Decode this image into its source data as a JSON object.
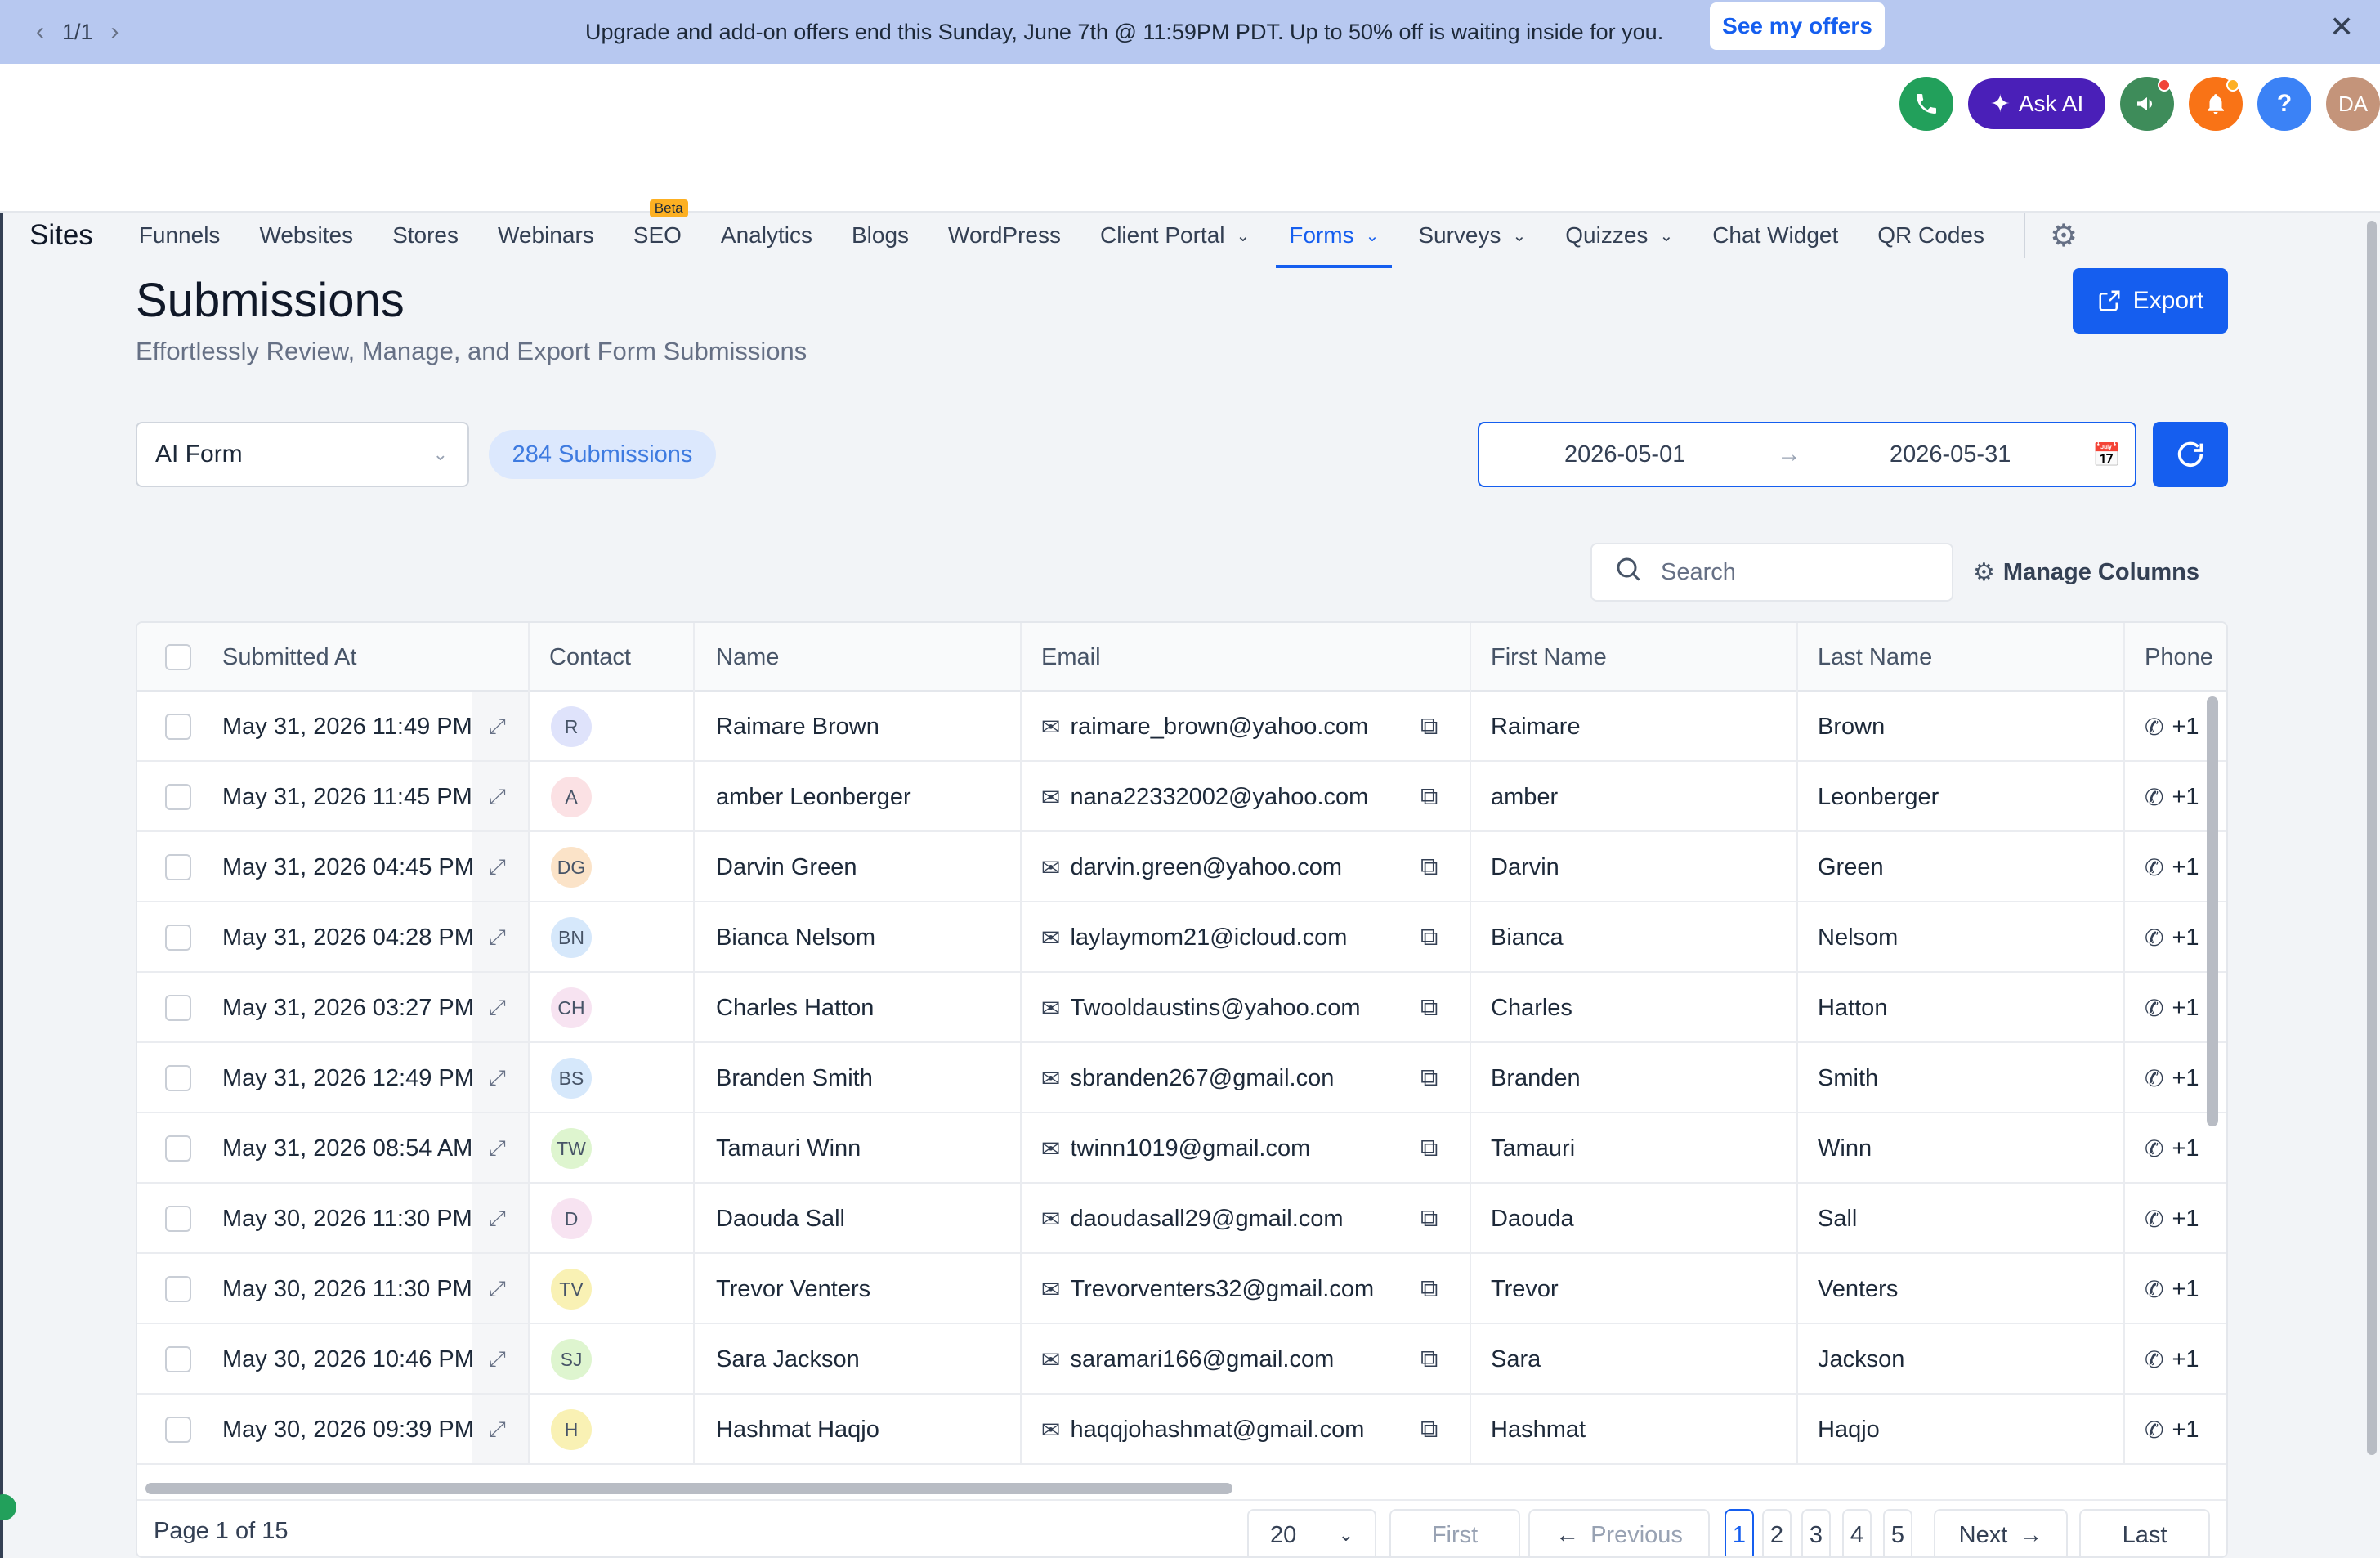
{
  "banner": {
    "pager": "1/1",
    "message": "Upgrade and add-on offers end this Sunday, June 7th @ 11:59PM PDT. Up to 50% off is waiting inside for you.",
    "cta": "See my offers"
  },
  "header": {
    "ask_ai": "Ask AI",
    "avatar_initials": "DA",
    "help": "?"
  },
  "nav": {
    "brand": "Sites",
    "items": [
      {
        "label": "Funnels"
      },
      {
        "label": "Websites"
      },
      {
        "label": "Stores"
      },
      {
        "label": "Webinars"
      },
      {
        "label": "SEO",
        "badge": "Beta"
      },
      {
        "label": "Analytics"
      },
      {
        "label": "Blogs"
      },
      {
        "label": "WordPress"
      },
      {
        "label": "Client Portal"
      },
      {
        "label": "Forms"
      },
      {
        "label": "Surveys"
      },
      {
        "label": "Quizzes"
      },
      {
        "label": "Chat Widget"
      },
      {
        "label": "QR Codes"
      }
    ]
  },
  "page": {
    "title": "Submissions",
    "subtitle": "Effortlessly Review, Manage, and Export Form Submissions",
    "export": "Export"
  },
  "filters": {
    "form": "AI Form",
    "count": "284 Submissions",
    "date_start": "2026-05-01",
    "date_end": "2026-05-31",
    "search_placeholder": "Search",
    "manage_columns": "Manage Columns"
  },
  "table": {
    "columns": {
      "submitted_at": "Submitted At",
      "contact": "Contact",
      "name": "Name",
      "email": "Email",
      "first_name": "First Name",
      "last_name": "Last Name",
      "phone": "Phone"
    },
    "rows": [
      {
        "submitted": "May 31, 2026 11:49 PM",
        "initials": "R",
        "avatar_color": "#dfe3fb",
        "name": "Raimare Brown",
        "email": "raimare_brown@yahoo.com",
        "first": "Raimare",
        "last": "Brown",
        "phone": "+1"
      },
      {
        "submitted": "May 31, 2026 11:45 PM",
        "initials": "A",
        "avatar_color": "#fbe1e4",
        "name": "amber Leonberger",
        "email": "nana22332002@yahoo.com",
        "first": "amber",
        "last": "Leonberger",
        "phone": "+1"
      },
      {
        "submitted": "May 31, 2026 04:45 PM",
        "initials": "DG",
        "avatar_color": "#fbe3c8",
        "name": "Darvin Green",
        "email": "darvin.green@yahoo.com",
        "first": "Darvin",
        "last": "Green",
        "phone": "+1"
      },
      {
        "submitted": "May 31, 2026 04:28 PM",
        "initials": "BN",
        "avatar_color": "#d6e8fb",
        "name": "Bianca Nelsom",
        "email": "laylaymom21@icloud.com",
        "first": "Bianca",
        "last": "Nelsom",
        "phone": "+1"
      },
      {
        "submitted": "May 31, 2026 03:27 PM",
        "initials": "CH",
        "avatar_color": "#f7e3f1",
        "name": "Charles Hatton",
        "email": "Twooldaustins@yahoo.com",
        "first": "Charles",
        "last": "Hatton",
        "phone": "+1"
      },
      {
        "submitted": "May 31, 2026 12:49 PM",
        "initials": "BS",
        "avatar_color": "#d6e8fb",
        "name": "Branden Smith",
        "email": "sbranden267@gmail.con",
        "first": "Branden",
        "last": "Smith",
        "phone": "+1"
      },
      {
        "submitted": "May 31, 2026 08:54 AM",
        "initials": "TW",
        "avatar_color": "#def5cf",
        "name": "Tamauri Winn",
        "email": "twinn1019@gmail.com",
        "first": "Tamauri",
        "last": "Winn",
        "phone": "+1"
      },
      {
        "submitted": "May 30, 2026 11:30 PM",
        "initials": "D",
        "avatar_color": "#f7e3f1",
        "name": "Daouda Sall",
        "email": "daoudasall29@gmail.com",
        "first": "Daouda",
        "last": "Sall",
        "phone": "+1"
      },
      {
        "submitted": "May 30, 2026 11:30 PM",
        "initials": "TV",
        "avatar_color": "#f9f1b4",
        "name": "Trevor Venters",
        "email": "Trevorventers32@gmail.com",
        "first": "Trevor",
        "last": "Venters",
        "phone": "+1"
      },
      {
        "submitted": "May 30, 2026 10:46 PM",
        "initials": "SJ",
        "avatar_color": "#def5cf",
        "name": "Sara Jackson",
        "email": "saramari166@gmail.com",
        "first": "Sara",
        "last": "Jackson",
        "phone": "+1"
      },
      {
        "submitted": "May 30, 2026 09:39 PM",
        "initials": "H",
        "avatar_color": "#f9f1b4",
        "name": "Hashmat Haqjo",
        "email": "haqqjohashmat@gmail.com",
        "first": "Hashmat",
        "last": "Haqjo",
        "phone": "+1"
      }
    ]
  },
  "pagination": {
    "page_label": "Page 1 of 15",
    "page_size": "20",
    "first": "First",
    "previous": "Previous",
    "pages": [
      "1",
      "2",
      "3",
      "4",
      "5"
    ],
    "current": "1",
    "next": "Next",
    "last": "Last"
  },
  "colors": {
    "accent": "#155eef",
    "banner_bg": "#b7c8f0",
    "ask_ai_bg": "#4a1fb8"
  }
}
